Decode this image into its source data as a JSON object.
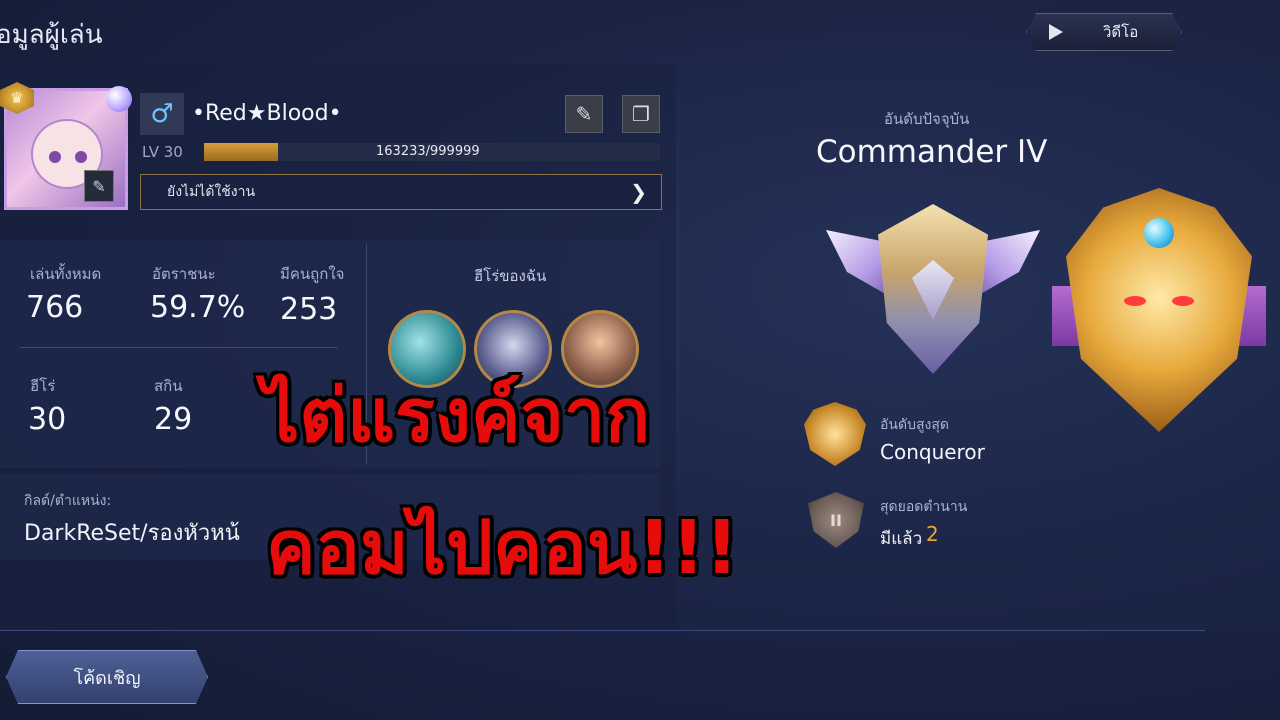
{
  "header": {
    "title": "อมูลผู้เล่น",
    "video_button": "วิดีโอ"
  },
  "player": {
    "name": "•Red★Blood•",
    "level_label": "LV 30",
    "exp_text": "163233/999999",
    "exp_fraction": 0.163,
    "status": "ยังไม่ได้ใช้งาน"
  },
  "stats": {
    "total_games_label": "เล่นทั้งหมด",
    "total_games": "766",
    "win_rate_label": "อัตราชนะ",
    "win_rate": "59.7%",
    "likes_label": "มีคนถูกใจ",
    "likes": "253",
    "heroes_label": "ฮีโร่",
    "heroes": "30",
    "skins_label": "สกิน",
    "skins": "29",
    "my_heroes_label": "ฮีโร่ของฉัน"
  },
  "guild": {
    "label": "กิลด์/ตำแหน่ง:",
    "value": "DarkReSet/รองหัวหน้"
  },
  "invite_button": "โค้ดเชิญ",
  "overlay": {
    "line1": "ไต่แรงค์จาก",
    "line2": "คอมไปคอน!!!"
  },
  "rank": {
    "current_label": "อันดับปัจจุบัน",
    "current": "Commander IV",
    "highest_label": "อันดับสูงสุด",
    "highest": "Conqueror",
    "legend_label": "สุดยอดตำนาน",
    "legend_prefix": "มีแล้ว",
    "legend_count": "2",
    "legend_badge_numeral": "II"
  },
  "icons": {
    "gender": "male-icon",
    "edit": "pencil-icon",
    "copy": "copy-icon",
    "play": "play-icon",
    "arrow": "chevron-right-icon"
  },
  "colors": {
    "accent_gold": "#d59d3c",
    "overlay_red": "#e70c0c",
    "legend_count": "#f0a23a"
  }
}
